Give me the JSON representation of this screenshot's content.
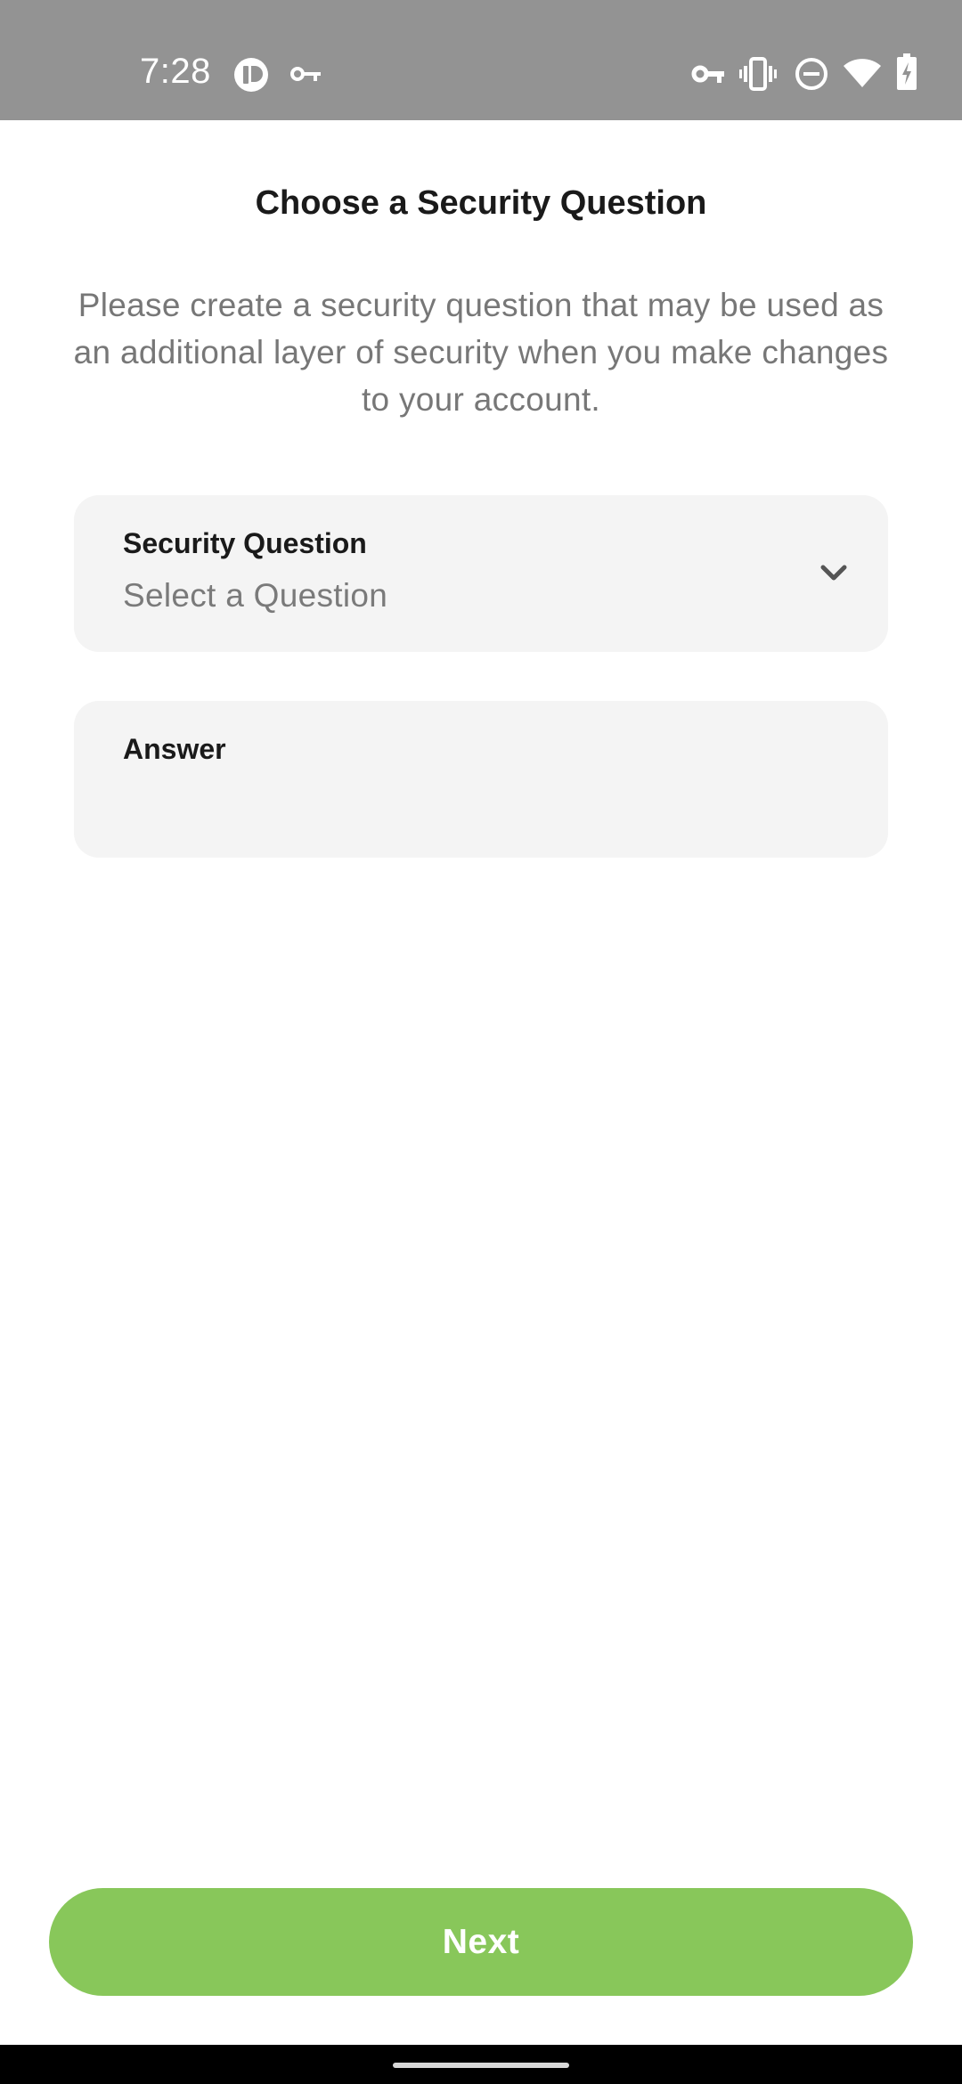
{
  "status_bar": {
    "time": "7:28",
    "left_icons": [
      "app-notification-icon",
      "key-icon"
    ],
    "right_icons": [
      "vpn-key-icon",
      "vibrate-icon",
      "do-not-disturb-icon",
      "wifi-icon",
      "battery-charging-icon"
    ]
  },
  "header": {
    "title": "Choose a Security Question"
  },
  "main": {
    "description": "Please create a security question that may be used as an additional layer of security when you make changes to your account.",
    "security_question": {
      "label": "Security Question",
      "value": "Select a Question"
    },
    "answer": {
      "label": "Answer",
      "value": ""
    }
  },
  "footer": {
    "next_label": "Next"
  },
  "colors": {
    "accent": "#88c75a",
    "status_bar": "#939393",
    "field_background": "#f4f4f4"
  }
}
